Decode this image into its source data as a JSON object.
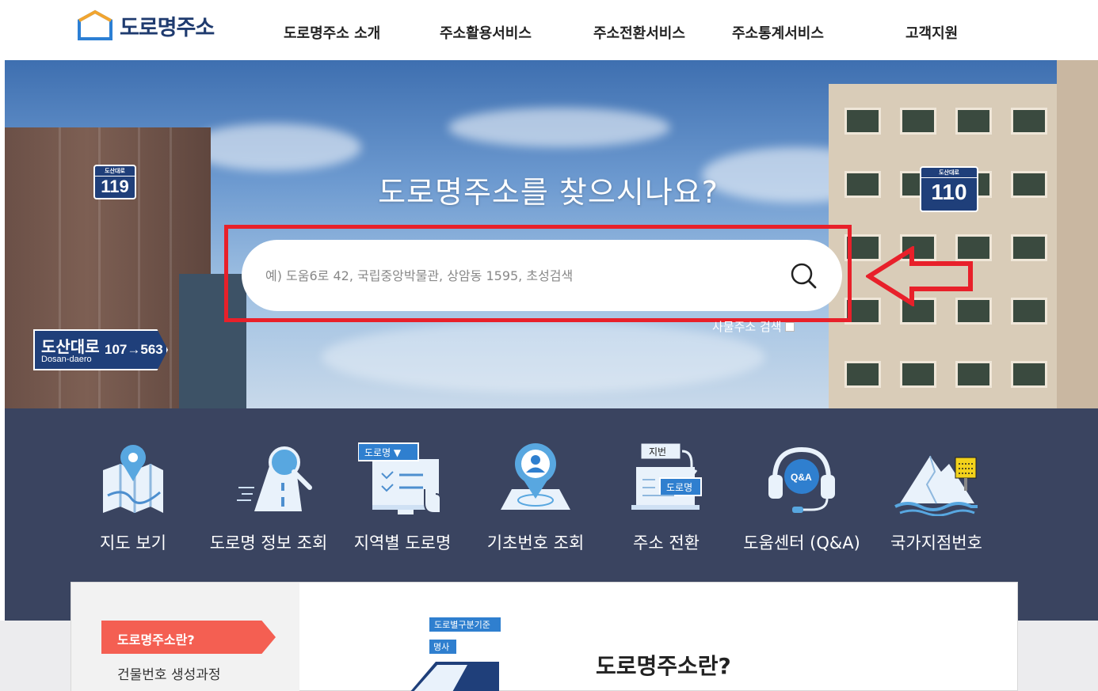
{
  "header": {
    "logo_text": "도로명주소",
    "nav": [
      {
        "label": "도로명주소 소개"
      },
      {
        "label": "주소활용서비스"
      },
      {
        "label": "주소전환서비스"
      },
      {
        "label": "주소통계서비스"
      },
      {
        "label": "고객지원"
      }
    ]
  },
  "hero": {
    "title": "도로명주소를 찾으시나요?",
    "search_placeholder": "예) 도움6로 42, 국립중앙박물관, 상암동 1595, 초성검색",
    "old_address_label": "사물주소 검색",
    "signs": {
      "left_small": {
        "top": "도산대로",
        "num": "119"
      },
      "right_small": {
        "top": "도산대로",
        "num": "110"
      },
      "road": {
        "kr": "도산대로",
        "en": "Dosan-daero",
        "nums": "107→563"
      }
    }
  },
  "quick_menu": [
    {
      "label": "지도 보기",
      "icon": "map-icon"
    },
    {
      "label": "도로명 정보 조회",
      "icon": "road-search-icon"
    },
    {
      "label": "지역별 도로명",
      "icon": "region-monitor-icon"
    },
    {
      "label": "기초번호 조회",
      "icon": "location-pin-icon"
    },
    {
      "label": "주소 전환",
      "icon": "address-convert-icon"
    },
    {
      "label": "도움센터 (Q&A)",
      "icon": "headset-icon"
    },
    {
      "label": "국가지점번호",
      "icon": "mountain-sign-icon"
    }
  ],
  "quick_menu_badges": {
    "road_name": "도로명 ▼",
    "jibun": "지번",
    "doro": "도로명",
    "qa": "Q&A"
  },
  "intro": {
    "side_active": "도로명주소란?",
    "side_item": "건물번호 생성과정",
    "title": "도로명주소란?",
    "illu_tag1": "도로별구분기준",
    "illu_tag2": "명사"
  },
  "colors": {
    "brand": "#1f3b6f",
    "highlight": "#e8202a",
    "band": "#3a4460",
    "side_active": "#f45f52"
  }
}
